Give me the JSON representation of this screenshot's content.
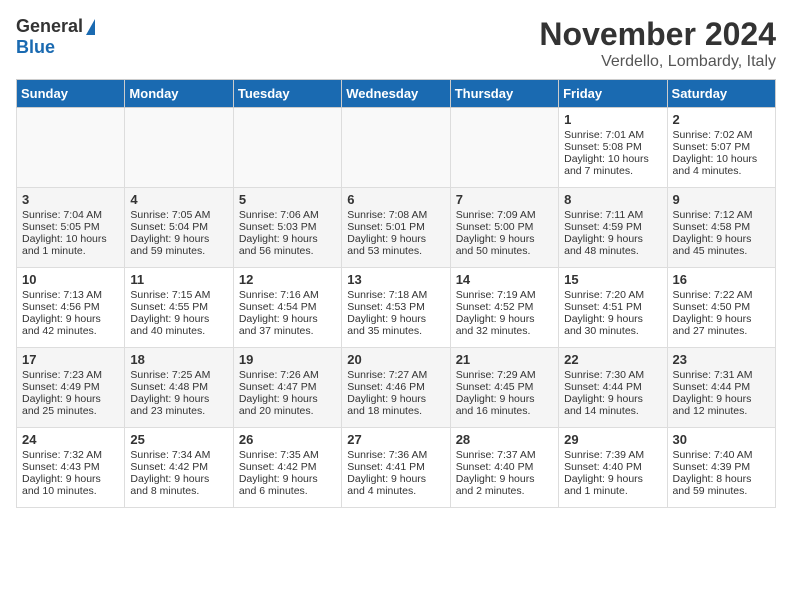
{
  "header": {
    "logo_general": "General",
    "logo_blue": "Blue",
    "month": "November 2024",
    "location": "Verdello, Lombardy, Italy"
  },
  "weekdays": [
    "Sunday",
    "Monday",
    "Tuesday",
    "Wednesday",
    "Thursday",
    "Friday",
    "Saturday"
  ],
  "weeks": [
    [
      {
        "day": "",
        "info": ""
      },
      {
        "day": "",
        "info": ""
      },
      {
        "day": "",
        "info": ""
      },
      {
        "day": "",
        "info": ""
      },
      {
        "day": "",
        "info": ""
      },
      {
        "day": "1",
        "info": "Sunrise: 7:01 AM\nSunset: 5:08 PM\nDaylight: 10 hours\nand 7 minutes."
      },
      {
        "day": "2",
        "info": "Sunrise: 7:02 AM\nSunset: 5:07 PM\nDaylight: 10 hours\nand 4 minutes."
      }
    ],
    [
      {
        "day": "3",
        "info": "Sunrise: 7:04 AM\nSunset: 5:05 PM\nDaylight: 10 hours\nand 1 minute."
      },
      {
        "day": "4",
        "info": "Sunrise: 7:05 AM\nSunset: 5:04 PM\nDaylight: 9 hours\nand 59 minutes."
      },
      {
        "day": "5",
        "info": "Sunrise: 7:06 AM\nSunset: 5:03 PM\nDaylight: 9 hours\nand 56 minutes."
      },
      {
        "day": "6",
        "info": "Sunrise: 7:08 AM\nSunset: 5:01 PM\nDaylight: 9 hours\nand 53 minutes."
      },
      {
        "day": "7",
        "info": "Sunrise: 7:09 AM\nSunset: 5:00 PM\nDaylight: 9 hours\nand 50 minutes."
      },
      {
        "day": "8",
        "info": "Sunrise: 7:11 AM\nSunset: 4:59 PM\nDaylight: 9 hours\nand 48 minutes."
      },
      {
        "day": "9",
        "info": "Sunrise: 7:12 AM\nSunset: 4:58 PM\nDaylight: 9 hours\nand 45 minutes."
      }
    ],
    [
      {
        "day": "10",
        "info": "Sunrise: 7:13 AM\nSunset: 4:56 PM\nDaylight: 9 hours\nand 42 minutes."
      },
      {
        "day": "11",
        "info": "Sunrise: 7:15 AM\nSunset: 4:55 PM\nDaylight: 9 hours\nand 40 minutes."
      },
      {
        "day": "12",
        "info": "Sunrise: 7:16 AM\nSunset: 4:54 PM\nDaylight: 9 hours\nand 37 minutes."
      },
      {
        "day": "13",
        "info": "Sunrise: 7:18 AM\nSunset: 4:53 PM\nDaylight: 9 hours\nand 35 minutes."
      },
      {
        "day": "14",
        "info": "Sunrise: 7:19 AM\nSunset: 4:52 PM\nDaylight: 9 hours\nand 32 minutes."
      },
      {
        "day": "15",
        "info": "Sunrise: 7:20 AM\nSunset: 4:51 PM\nDaylight: 9 hours\nand 30 minutes."
      },
      {
        "day": "16",
        "info": "Sunrise: 7:22 AM\nSunset: 4:50 PM\nDaylight: 9 hours\nand 27 minutes."
      }
    ],
    [
      {
        "day": "17",
        "info": "Sunrise: 7:23 AM\nSunset: 4:49 PM\nDaylight: 9 hours\nand 25 minutes."
      },
      {
        "day": "18",
        "info": "Sunrise: 7:25 AM\nSunset: 4:48 PM\nDaylight: 9 hours\nand 23 minutes."
      },
      {
        "day": "19",
        "info": "Sunrise: 7:26 AM\nSunset: 4:47 PM\nDaylight: 9 hours\nand 20 minutes."
      },
      {
        "day": "20",
        "info": "Sunrise: 7:27 AM\nSunset: 4:46 PM\nDaylight: 9 hours\nand 18 minutes."
      },
      {
        "day": "21",
        "info": "Sunrise: 7:29 AM\nSunset: 4:45 PM\nDaylight: 9 hours\nand 16 minutes."
      },
      {
        "day": "22",
        "info": "Sunrise: 7:30 AM\nSunset: 4:44 PM\nDaylight: 9 hours\nand 14 minutes."
      },
      {
        "day": "23",
        "info": "Sunrise: 7:31 AM\nSunset: 4:44 PM\nDaylight: 9 hours\nand 12 minutes."
      }
    ],
    [
      {
        "day": "24",
        "info": "Sunrise: 7:32 AM\nSunset: 4:43 PM\nDaylight: 9 hours\nand 10 minutes."
      },
      {
        "day": "25",
        "info": "Sunrise: 7:34 AM\nSunset: 4:42 PM\nDaylight: 9 hours\nand 8 minutes."
      },
      {
        "day": "26",
        "info": "Sunrise: 7:35 AM\nSunset: 4:42 PM\nDaylight: 9 hours\nand 6 minutes."
      },
      {
        "day": "27",
        "info": "Sunrise: 7:36 AM\nSunset: 4:41 PM\nDaylight: 9 hours\nand 4 minutes."
      },
      {
        "day": "28",
        "info": "Sunrise: 7:37 AM\nSunset: 4:40 PM\nDaylight: 9 hours\nand 2 minutes."
      },
      {
        "day": "29",
        "info": "Sunrise: 7:39 AM\nSunset: 4:40 PM\nDaylight: 9 hours\nand 1 minute."
      },
      {
        "day": "30",
        "info": "Sunrise: 7:40 AM\nSunset: 4:39 PM\nDaylight: 8 hours\nand 59 minutes."
      }
    ]
  ]
}
